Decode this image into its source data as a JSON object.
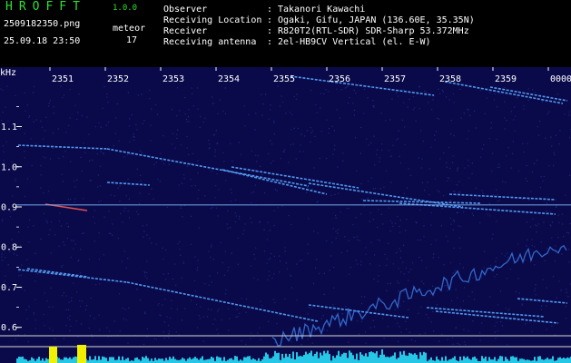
{
  "app": {
    "title": "HROFFT",
    "version": "1.0.0"
  },
  "file": {
    "name": "2509182350.png",
    "datetime": "25.09.18 23:50"
  },
  "meteor": {
    "label": "meteor",
    "count": "17"
  },
  "info": [
    {
      "key": "Observer",
      "value": "Takanori Kawachi"
    },
    {
      "key": "Receiving Location",
      "value": "Ogaki, Gifu, JAPAN (136.60E, 35.35N)"
    },
    {
      "key": "Receiver",
      "value": "R820T2(RTL-SDR) SDR-Sharp 53.372MHz"
    },
    {
      "key": "Receiving antenna",
      "value": "2el-HB9CV Vertical (el. E-W)"
    }
  ],
  "info_separator": ":",
  "chart_data": {
    "type": "heatmap",
    "xlabel": "",
    "ylabel": "kHz",
    "x_tick_labels": [
      "2351",
      "2352",
      "2353",
      "2354",
      "2355",
      "2356",
      "2357",
      "2358",
      "2359",
      "0000"
    ],
    "y_tick_labels": [
      "1.1",
      "1.0",
      "0.9",
      "0.8",
      "0.7",
      "0.6"
    ],
    "y_ticks_khz": [
      1.1,
      1.0,
      0.9,
      0.8,
      0.7,
      0.6
    ],
    "ylim_khz": [
      0.57,
      1.23
    ],
    "carrier_khz": 0.905,
    "colors": {
      "background": "#0a0a4a",
      "trace": "#5aa8ff",
      "carrier": "#7fb8ff",
      "noise_band": "#26c6e6",
      "axis_text": "#ffffff",
      "header_green": "#2ee02e"
    }
  }
}
